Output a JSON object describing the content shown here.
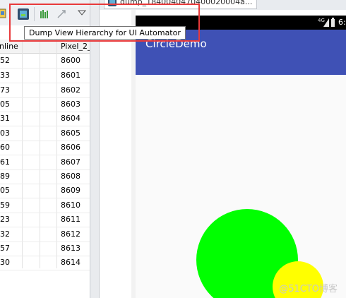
{
  "toolbar": {
    "icons": [
      "device-screen-icon",
      "dump-view-hierarchy-icon",
      "systrace-icon",
      "stop-trace-icon",
      "menu-dropdown-icon"
    ]
  },
  "tooltip": {
    "text": "Dump View Hierarchy for UI Automator"
  },
  "device_table": {
    "headers": {
      "online": "nline",
      "pixel": "Pixel_2_"
    },
    "rows": [
      {
        "id": "52",
        "port": "8600"
      },
      {
        "id": "33",
        "port": "8601"
      },
      {
        "id": "73",
        "port": "8602"
      },
      {
        "id": "05",
        "port": "8603"
      },
      {
        "id": "31",
        "port": "8604"
      },
      {
        "id": "03",
        "port": "8605"
      },
      {
        "id": "60",
        "port": "8606"
      },
      {
        "id": "61",
        "port": "8607"
      },
      {
        "id": "89",
        "port": "8608"
      },
      {
        "id": "05",
        "port": "8609"
      },
      {
        "id": "59",
        "port": "8610"
      },
      {
        "id": "23",
        "port": "8611"
      },
      {
        "id": "32",
        "port": "8612"
      },
      {
        "id": "57",
        "port": "8613"
      },
      {
        "id": "30",
        "port": "8614"
      }
    ]
  },
  "editor": {
    "tab_label": "dump_1840040470400020004a..."
  },
  "device_screen": {
    "status_bar": {
      "signal": "4G",
      "time": "6:"
    },
    "app_title": "CircleDemo",
    "circles": [
      {
        "name": "green-circle",
        "color": "#00ff00"
      },
      {
        "name": "yellow-circle",
        "color": "#ffff00"
      }
    ]
  },
  "colors": {
    "app_bar": "#3f51b5",
    "highlight": "#e8393a",
    "green": "#00ff00",
    "yellow": "#ffff00"
  },
  "watermark": "@51CTO博客"
}
